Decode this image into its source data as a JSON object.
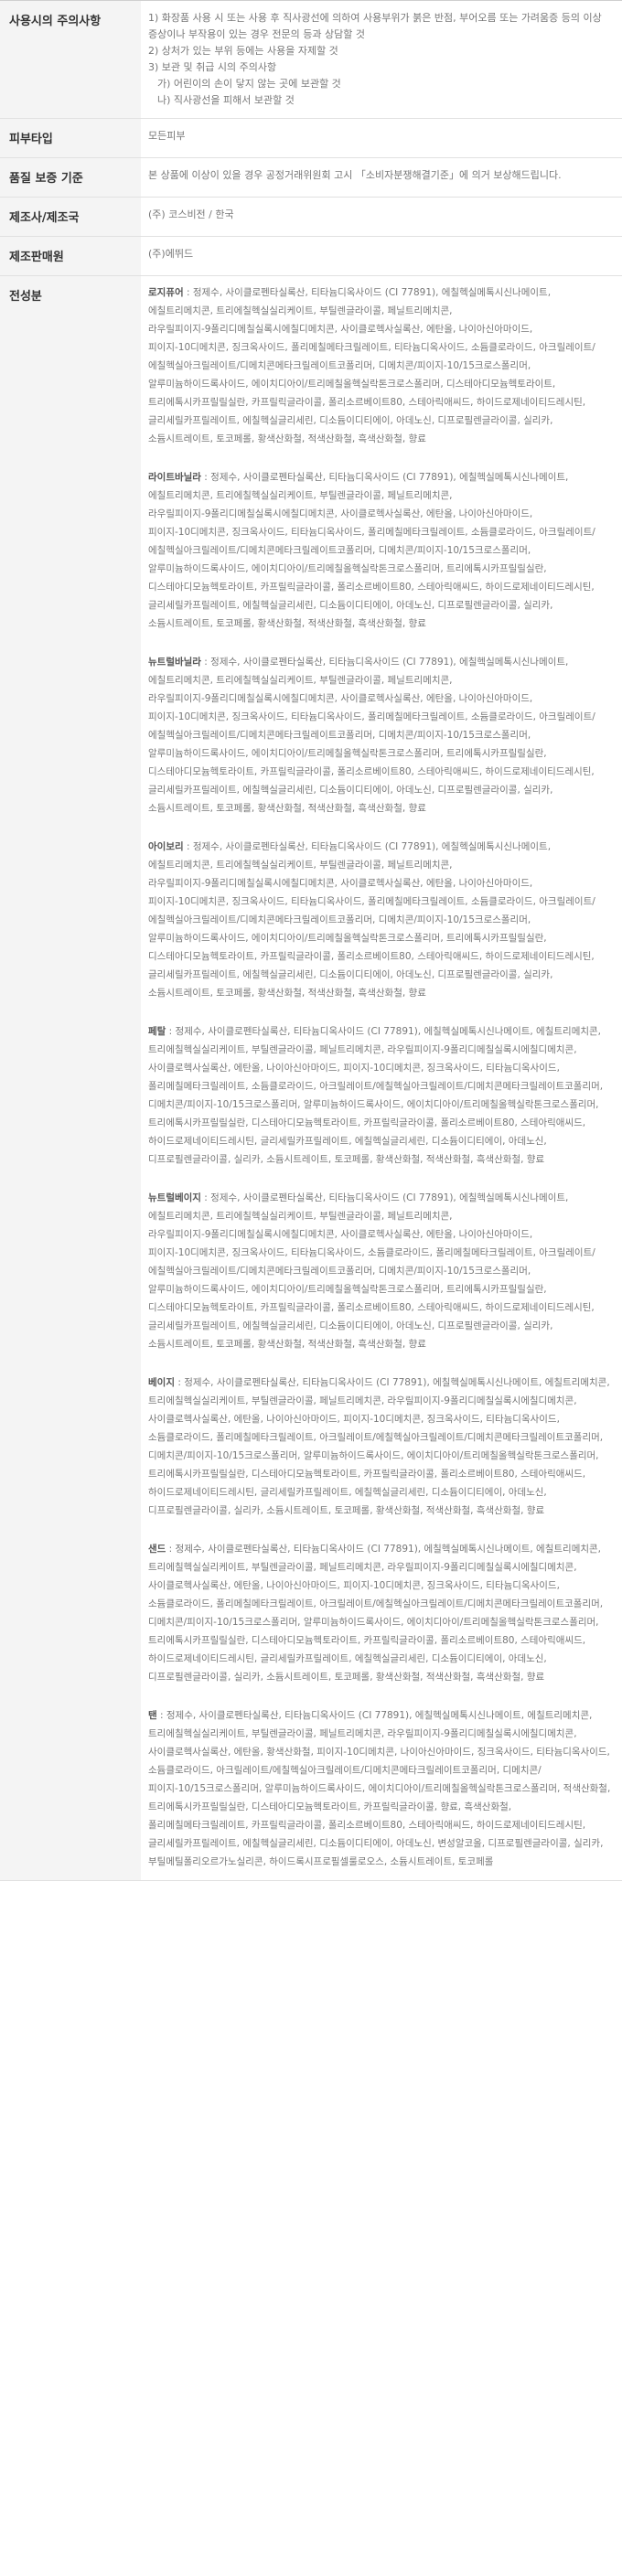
{
  "rows": {
    "precautions": {
      "label": "사용시의 주의사항",
      "lines": [
        "1) 화장품 사용 시 또는 사용 후 직사광선에 의하여 사용부위가 붉은 반점, 부어오름 또는 가려움증 등의 이상 증상이나 부작용이 있는 경우 전문의 등과 상담할 것",
        "2) 상처가 있는 부위 등에는 사용을 자제할 것",
        "3) 보관 및 취급 시의 주의사항",
        "가) 어린이의 손이 닿지 않는 곳에 보관할 것",
        "나) 직사광선을 피해서 보관할 것"
      ]
    },
    "skin_type": {
      "label": "피부타입",
      "value": "모든피부"
    },
    "quality": {
      "label": "품질 보증 기준",
      "value": "본 상품에 이상이 있을 경우 공정거래위원회 고시 「소비자분쟁해결기준」에 의거 보상해드립니다."
    },
    "manufacturer": {
      "label": "제조사/제조국",
      "value": "(주) 코스비전 / 한국"
    },
    "seller": {
      "label": "제조판매원",
      "value": "(주)에뛰드"
    },
    "ingredients": {
      "label": "전성분",
      "groups": [
        {
          "name": "로지퓨어",
          "text": " : 정제수, 사이클로펜타실록산, 티타늄디옥사이드 (CI 77891), 에칠헥실메톡시신나메이트, 에칠트리메치콘, 트리에칠헥실실리케이트, 부틸렌글라이콜, 페닐트리메치콘, 라우릴피이지-9폴리디메칠실록시에칠디메치콘, 사이클로헥사실록산, 에탄올, 나이아신아마이드, 피이지-10디메치콘, 징크옥사이드, 폴리메칠메타크릴레이트, 티타늄디옥사이드, 소듐클로라이드, 아크릴레이트/에칠헥실아크릴레이트/디메치콘메타크릴레이트코폴리머, 디메치콘/피이지-10/15크로스폴리머, 알루미늄하이드록사이드, 에이치디아이/트리메칠올헥실락톤크로스폴리머, 디스테아디모늄헥토라이트, 트리에톡시카프릴릴실란, 카프릴릭글라이콜, 폴리소르베이트80, 스테아릭애씨드, 하이드로제네이티드레시틴, 글리세릴카프릴레이트, 에칠헥실글리세린, 디소듐이디티에이, 아데노신, 디프로필렌글라이콜, 실리카, 소듐시트레이트, 토코페롤, 황색산화철, 적색산화철, 흑색산화철, 향료"
        },
        {
          "name": "라이트바닐라",
          "text": " : 정제수, 사이클로펜타실록산, 티타늄디옥사이드 (CI 77891), 에칠헥실메톡시신나메이트, 에칠트리메치콘, 트리에칠헥실실리케이트, 부틸렌글라이콜, 페닐트리메치콘, 라우릴피이지-9폴리디메칠실록시에칠디메치콘, 사이클로헥사실록산, 에탄올, 나이아신아마이드, 피이지-10디메치콘, 징크옥사이드, 티타늄디옥사이드, 폴리메칠메타크릴레이트, 소듐클로라이드, 아크릴레이트/에칠헥실아크릴레이트/디메치콘메타크릴레이트코폴리머, 디메치콘/피이지-10/15크로스폴리머, 알루미늄하이드록사이드, 에이치디아이/트리메칠올헥실락톤크로스폴리머, 트리에톡시카프릴릴실란, 디스테아디모늄헥토라이트, 카프릴릭글라이콜, 폴리소르베이트80, 스테아릭애씨드, 하이드로제네이티드레시틴, 글리세릴카프릴레이트, 에칠헥실글리세린, 디소듐이디티에이, 아데노신, 디프로필렌글라이콜, 실리카, 소듐시트레이트, 토코페롤, 황색산화철, 적색산화철, 흑색산화철, 향료"
        },
        {
          "name": "뉴트럴바닐라",
          "text": " : 정제수, 사이클로펜타실록산, 티타늄디옥사이드 (CI 77891), 에칠헥실메톡시신나메이트, 에칠트리메치콘, 트리에칠헥실실리케이트, 부틸렌글라이콜, 페닐트리메치콘, 라우릴피이지-9폴리디메칠실록시에칠디메치콘, 사이클로헥사실록산, 에탄올, 나이아신아마이드, 피이지-10디메치콘, 징크옥사이드, 티타늄디옥사이드, 폴리메칠메타크릴레이트, 소듐클로라이드, 아크릴레이트/에칠헥실아크릴레이트/디메치콘메타크릴레이트코폴리머, 디메치콘/피이지-10/15크로스폴리머, 알루미늄하이드록사이드, 에이치디아이/트리메칠올헥실락톤크로스폴리머, 트리에톡시카프릴릴실란, 디스테아디모늄헥토라이트, 카프릴릭글라이콜, 폴리소르베이트80, 스테아릭애씨드, 하이드로제네이티드레시틴, 글리세릴카프릴레이트, 에칠헥실글리세린, 디소듐이디티에이, 아데노신, 디프로필렌글라이콜, 실리카, 소듐시트레이트, 토코페롤, 황색산화철, 적색산화철, 흑색산화철, 향료"
        },
        {
          "name": "아이보리",
          "text": " : 정제수, 사이클로펜타실록산, 티타늄디옥사이드 (CI 77891), 에칠헥실메톡시신나메이트, 에칠트리메치콘, 트리에칠헥실실리케이트, 부틸렌글라이콜, 페닐트리메치콘, 라우릴피이지-9폴리디메칠실록시에칠디메치콘, 사이클로헥사실록산, 에탄올, 나이아신아마이드, 피이지-10디메치콘, 징크옥사이드, 티타늄디옥사이드, 폴리메칠메타크릴레이트, 소듐클로라이드, 아크릴레이트/에칠헥실아크릴레이트/디메치콘메타크릴레이트코폴리머, 디메치콘/피이지-10/15크로스폴리머, 알루미늄하이드록사이드, 에이치디아이/트리메칠올헥실락톤크로스폴리머, 트리에톡시카프릴릴실란, 디스테아디모늄헥토라이트, 카프릴릭글라이콜, 폴리소르베이트80, 스테아릭애씨드, 하이드로제네이티드레시틴, 글리세릴카프릴레이트, 에칠헥실글리세린, 디소듐이디티에이, 아데노신, 디프로필렌글라이콜, 실리카, 소듐시트레이트, 토코페롤, 황색산화철, 적색산화철, 흑색산화철, 향료"
        },
        {
          "name": "페탈",
          "text": " : 정제수, 사이클로펜타실록산, 티타늄디옥사이드 (CI 77891), 에칠헥실메톡시신나메이트, 에칠트리메치콘, 트리에칠헥실실리케이트, 부틸렌글라이콜, 페닐트리메치콘, 라우릴피이지-9폴리디메칠실록시에칠디메치콘, 사이클로헥사실록산, 에탄올, 나이아신아마이드, 피이지-10디메치콘, 징크옥사이드, 티타늄디옥사이드, 폴리메칠메타크릴레이트, 소듐클로라이드, 아크릴레이트/에칠헥실아크릴레이트/디메치콘메타크릴레이트코폴리머, 디메치콘/피이지-10/15크로스폴리머, 알루미늄하이드록사이드, 에이치디아이/트리메칠올헥실락톤크로스폴리머, 트리에톡시카프릴릴실란, 디스테아디모늄헥토라이트, 카프릴릭글라이콜, 폴리소르베이트80, 스테아릭애씨드, 하이드로제네이티드레시틴, 글리세릴카프릴레이트, 에칠헥실글리세린, 디소듐이디티에이, 아데노신, 디프로필렌글라이콜, 실리카, 소듐시트레이트, 토코페롤, 황색산화철, 적색산화철, 흑색산화철, 향료"
        },
        {
          "name": "뉴트럴베이지",
          "text": " : 정제수, 사이클로펜타실록산, 티타늄디옥사이드 (CI 77891), 에칠헥실메톡시신나메이트, 에칠트리메치콘, 트리에칠헥실실리케이트, 부틸렌글라이콜, 페닐트리메치콘, 라우릴피이지-9폴리디메칠실록시에칠디메치콘, 사이클로헥사실록산, 에탄올, 나이아신아마이드, 피이지-10디메치콘, 징크옥사이드, 티타늄디옥사이드, 소듐클로라이드, 폴리메칠메타크릴레이트, 아크릴레이트/에칠헥실아크릴레이트/디메치콘메타크릴레이트코폴리머, 디메치콘/피이지-10/15크로스폴리머, 알루미늄하이드록사이드, 에이치디아이/트리메칠올헥실락톤크로스폴리머, 트리에톡시카프릴릴실란, 디스테아디모늄헥토라이트, 카프릴릭글라이콜, 폴리소르베이트80, 스테아릭애씨드, 하이드로제네이티드레시틴, 글리세릴카프릴레이트, 에칠헥실글리세린, 디소듐이디티에이, 아데노신, 디프로필렌글라이콜, 실리카, 소듐시트레이트, 토코페롤, 황색산화철, 적색산화철, 흑색산화철, 향료"
        },
        {
          "name": "베이지",
          "text": " : 정제수, 사이클로펜타실록산, 티타늄디옥사이드 (CI 77891), 에칠헥실메톡시신나메이트, 에칠트리메치콘, 트리에칠헥실실리케이트, 부틸렌글라이콜, 페닐트리메치콘, 라우릴피이지-9폴리디메칠실록시에칠디메치콘, 사이클로헥사실록산, 에탄올, 나이아신아마이드, 피이지-10디메치콘, 징크옥사이드, 티타늄디옥사이드, 소듐클로라이드, 폴리메칠메타크릴레이트, 아크릴레이트/에칠헥실아크릴레이트/디메치콘메타크릴레이트코폴리머, 디메치콘/피이지-10/15크로스폴리머, 알루미늄하이드록사이드, 에이치디아이/트리메칠올헥실락톤크로스폴리머, 트리에톡시카프릴릴실란, 디스테아디모늄헥토라이트, 카프릴릭글라이콜, 폴리소르베이트80, 스테아릭애씨드, 하이드로제네이티드레시틴, 글리세릴카프릴레이트, 에칠헥실글리세린, 디소듐이디티에이, 아데노신, 디프로필렌글라이콜, 실리카, 소듐시트레이트, 토코페롤, 황색산화철, 적색산화철, 흑색산화철, 향료"
        },
        {
          "name": "샌드",
          "text": " : 정제수, 사이클로펜타실록산, 티타늄디옥사이드 (CI 77891), 에칠헥실메톡시신나메이트, 에칠트리메치콘, 트리에칠헥실실리케이트, 부틸렌글라이콜, 페닐트리메치콘, 라우릴피이지-9폴리디메칠실록시에칠디메치콘, 사이클로헥사실록산, 에탄올, 나이아신아마이드, 피이지-10디메치콘, 징크옥사이드, 티타늄디옥사이드, 소듐클로라이드, 폴리메칠메타크릴레이트, 아크릴레이트/에칠헥실아크릴레이트/디메치콘메타크릴레이트코폴리머, 디메치콘/피이지-10/15크로스폴리머, 알루미늄하이드록사이드, 에이치디아이/트리메칠올헥실락톤크로스폴리머, 트리에톡시카프릴릴실란, 디스테아디모늄헥토라이트, 카프릴릭글라이콜, 폴리소르베이트80, 스테아릭애씨드, 하이드로제네이티드레시틴, 글리세릴카프릴레이트, 에칠헥실글리세린, 디소듐이디티에이, 아데노신, 디프로필렌글라이콜, 실리카, 소듐시트레이트, 토코페롤, 황색산화철, 적색산화철, 흑색산화철, 향료"
        },
        {
          "name": "탠",
          "text": " : 정제수, 사이클로펜타실록산, 티타늄디옥사이드 (CI 77891), 에칠헥실메톡시신나메이트, 에칠트리메치콘, 트리에칠헥실실리케이트, 부틸렌글라이콜, 페닐트리메치콘, 라우릴피이지-9폴리디메칠실록시에칠디메치콘, 사이클로헥사실록산, 에탄올, 황색산화철, 피이지-10디메치콘, 나이아신아마이드, 징크옥사이드, 티타늄디옥사이드, 소듐클로라이드, 아크릴레이트/에칠헥실아크릴레이트/디메치콘메타크릴레이트코폴리머, 디메치콘/피이지-10/15크로스폴리머, 알루미늄하이드록사이드, 에이치디아이/트리메칠올헥실락톤크로스폴리머, 적색산화철, 트리에톡시카프릴릴실란, 디스테아디모늄헥토라이트, 카프릴릭글라이콜, 향료, 흑색산화철, 폴리메칠메타크릴레이트, 카프릴릭글라이콜, 폴리소르베이트80, 스테아릭애씨드, 하이드로제네이티드레시틴, 글리세릴카프릴레이트, 에칠헥실글리세린, 디소듐이디티에이, 아데노신, 변성알코올, 디프로필렌글라이콜, 실리카, 부틸메틸폴리오르가노실리콘, 하이드록시프로필셀룰로오스, 소듐시트레이트, 토코페롤"
        }
      ]
    }
  }
}
